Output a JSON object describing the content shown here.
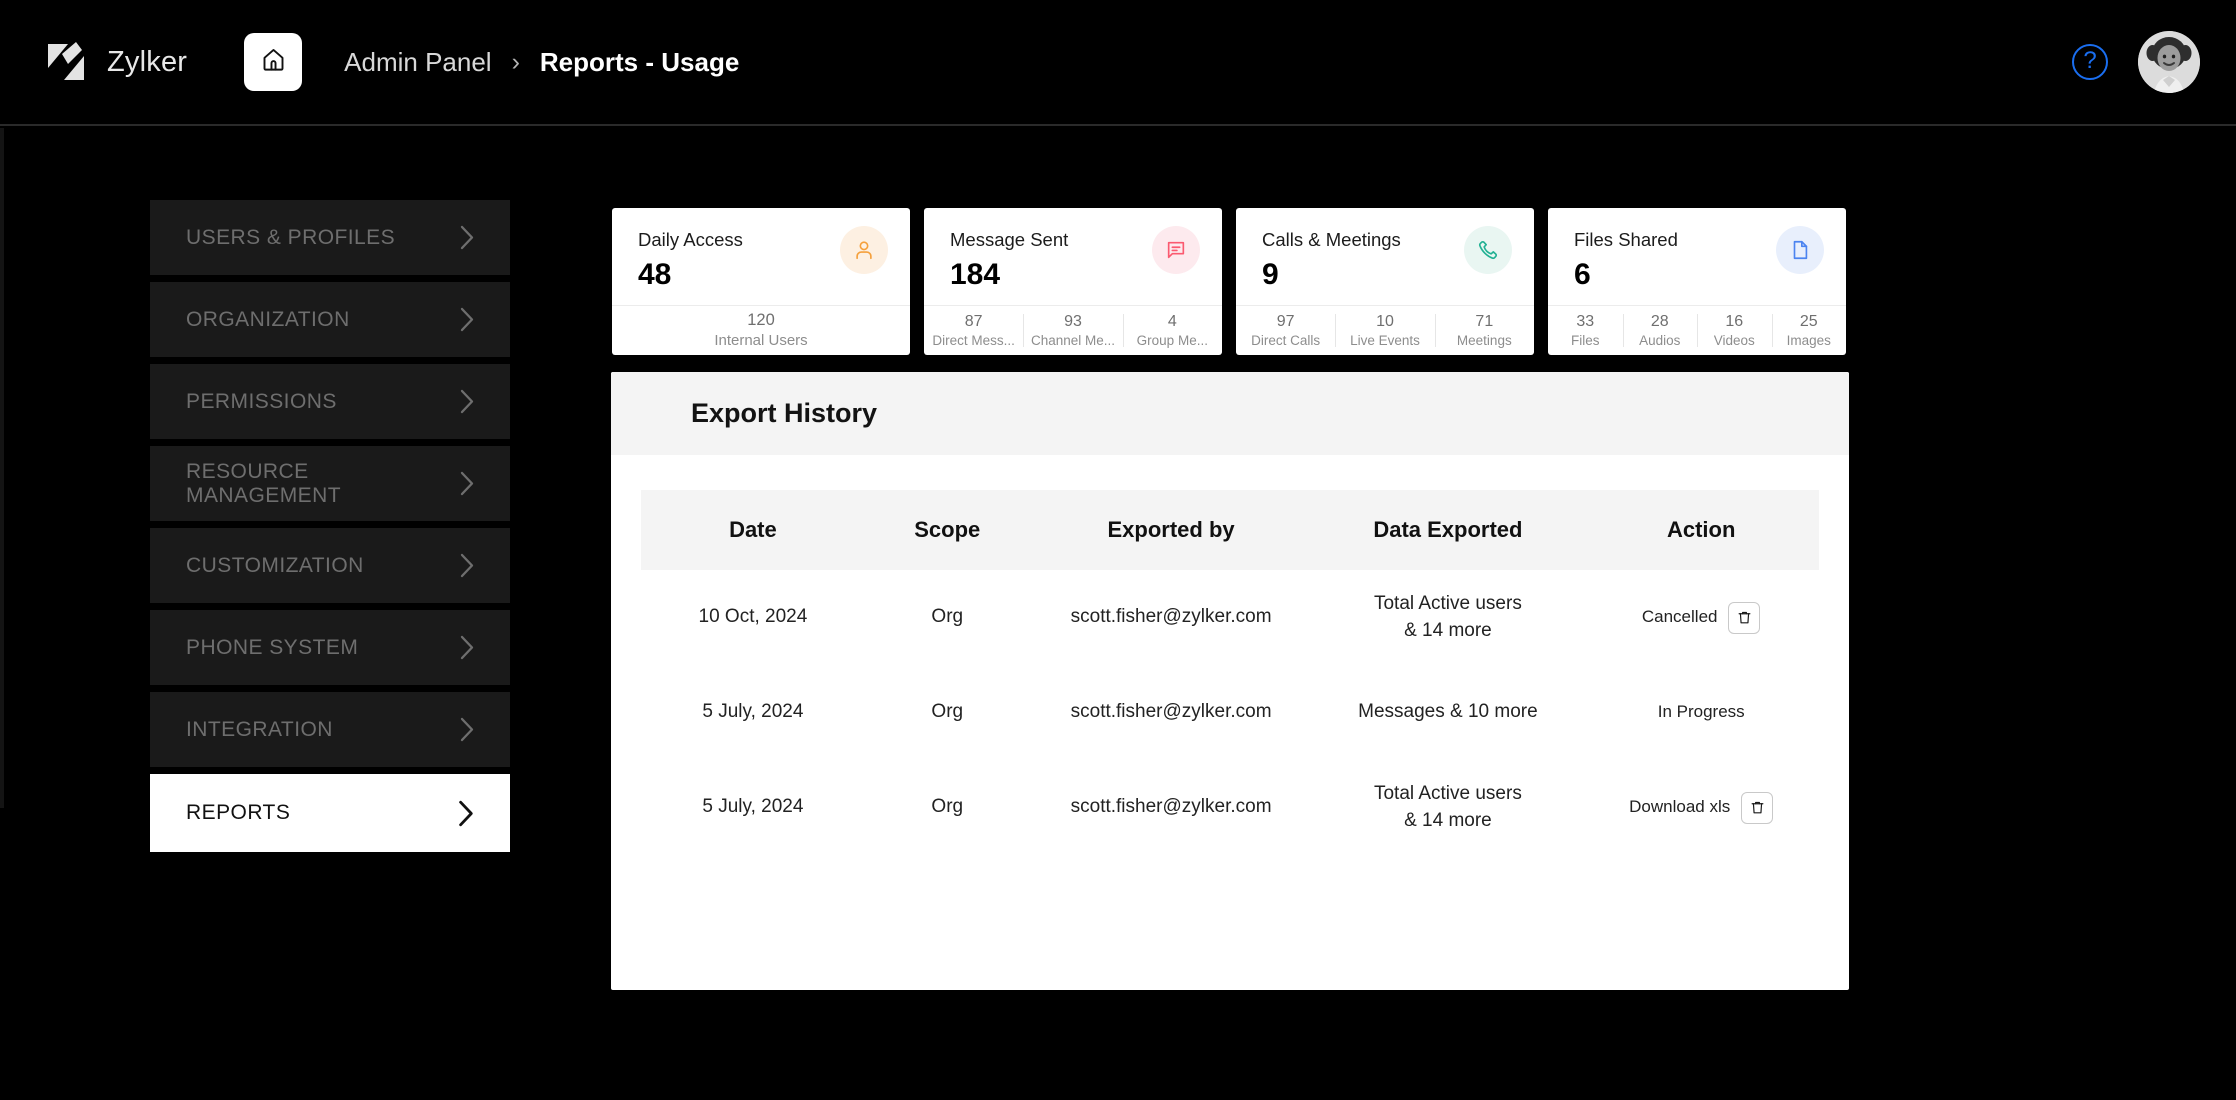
{
  "header": {
    "brand_name": "Zylker",
    "logo_icon": "zylker-logo",
    "home_icon": "home-icon",
    "breadcrumb": {
      "parent": "Admin Panel",
      "separator": "›",
      "current": "Reports - Usage"
    },
    "help_icon": "help-question-icon",
    "help_glyph": "?",
    "avatar_icon": "user-avatar",
    "accent_blue": "#1a6ef0",
    "background": "#000000"
  },
  "sidebar": {
    "items": [
      {
        "label": "USERS & PROFILES",
        "selected": false
      },
      {
        "label": "ORGANIZATION",
        "selected": false
      },
      {
        "label": "PERMISSIONS",
        "selected": false
      },
      {
        "label": "RESOURCE MANAGEMENT",
        "selected": false
      },
      {
        "label": "CUSTOMIZATION",
        "selected": false
      },
      {
        "label": "PHONE SYSTEM",
        "selected": false
      },
      {
        "label": "INTEGRATION",
        "selected": false
      },
      {
        "label": "REPORTS",
        "selected": true
      }
    ],
    "chevron_icon": "chevron-right-icon"
  },
  "stat_cards": [
    {
      "title": "Daily Access",
      "value": "48",
      "icon": "user-icon",
      "icon_color": "#f5a03c",
      "icon_bg": "#fdf0e2",
      "breakdown": [
        {
          "number": "120",
          "label": "Internal Users"
        }
      ]
    },
    {
      "title": "Message Sent",
      "value": "184",
      "icon": "message-icon",
      "icon_color": "#fb5a70",
      "icon_bg": "#fdeaee",
      "breakdown": [
        {
          "number": "87",
          "label": "Direct Mess..."
        },
        {
          "number": "93",
          "label": "Channel Me..."
        },
        {
          "number": "4",
          "label": "Group Me..."
        }
      ]
    },
    {
      "title": "Calls & Meetings",
      "value": "9",
      "icon": "phone-icon",
      "icon_color": "#22b193",
      "icon_bg": "#e9f6f2",
      "breakdown": [
        {
          "number": "97",
          "label": "Direct Calls"
        },
        {
          "number": "10",
          "label": "Live Events"
        },
        {
          "number": "71",
          "label": "Meetings"
        }
      ]
    },
    {
      "title": "Files Shared",
      "value": "6",
      "icon": "file-icon",
      "icon_color": "#4c84f0",
      "icon_bg": "#e8effc",
      "breakdown": [
        {
          "number": "33",
          "label": "Files"
        },
        {
          "number": "28",
          "label": "Audios"
        },
        {
          "number": "16",
          "label": "Videos"
        },
        {
          "number": "25",
          "label": "Images"
        }
      ]
    }
  ],
  "export_history": {
    "title": "Export History",
    "columns": [
      "Date",
      "Scope",
      "Exported by",
      "Data Exported",
      "Action"
    ],
    "rows": [
      {
        "date": "10 Oct, 2024",
        "scope": "Org",
        "exported_by": "scott.fisher@zylker.com",
        "data_exported_line1": "Total Active users",
        "data_exported_line2": "& 14 more",
        "action_text": "Cancelled",
        "has_trash": true,
        "trash_icon": "trash-icon"
      },
      {
        "date": "5 July, 2024",
        "scope": "Org",
        "exported_by": "scott.fisher@zylker.com",
        "data_exported_line1": "Messages & 10 more",
        "data_exported_line2": "",
        "action_text": "In Progress",
        "has_trash": false,
        "trash_icon": ""
      },
      {
        "date": "5 July, 2024",
        "scope": "Org",
        "exported_by": "scott.fisher@zylker.com",
        "data_exported_line1": "Total Active users",
        "data_exported_line2": "& 14 more",
        "action_text": "Download xls",
        "has_trash": true,
        "trash_icon": "trash-icon"
      }
    ]
  }
}
